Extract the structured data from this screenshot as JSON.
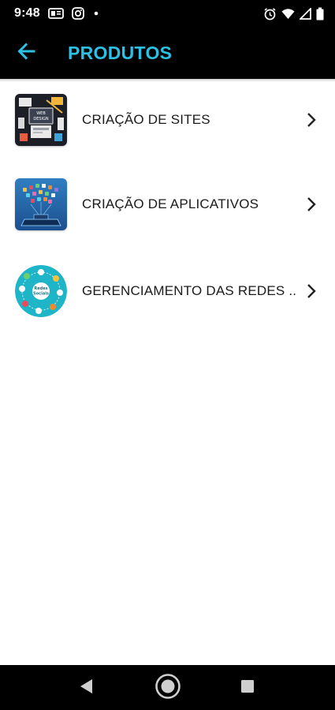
{
  "status_bar": {
    "time": "9:48",
    "left_icons": [
      "notification-card-icon",
      "instagram-icon",
      "dot-icon"
    ],
    "right_icons": [
      "alarm-icon",
      "wifi-icon",
      "signal-icon",
      "battery-icon"
    ]
  },
  "app_bar": {
    "title": "PRODUTOS",
    "back_icon": "arrow-left-icon",
    "title_color": "#2bc0e4",
    "background": "#000000"
  },
  "products": [
    {
      "label": "CRIAÇÃO DE SITES",
      "thumbnail": "web-design-thumbnail"
    },
    {
      "label": "CRIAÇÃO DE APLICATIVOS",
      "thumbnail": "app-development-thumbnail"
    },
    {
      "label": "GERENCIAMENTO DAS REDES ...",
      "thumbnail": "social-networks-thumbnail"
    }
  ],
  "thumb_text": {
    "web_1": "WEB",
    "web_2": "DESIGN",
    "social_1": "Redes",
    "social_2": "Sociais"
  },
  "nav_bar": {
    "buttons": [
      "back-triangle-icon",
      "home-circle-icon",
      "recents-square-icon"
    ]
  }
}
